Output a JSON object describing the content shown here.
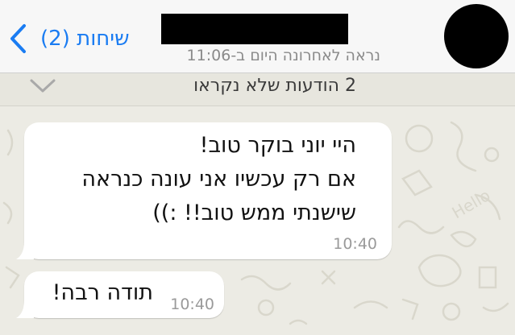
{
  "header": {
    "back_label": "שיחות (2)",
    "last_seen": "נראה לאחרונה היום ב-11:06"
  },
  "unread_banner": {
    "label": "2 הודעות שלא נקראו"
  },
  "messages": [
    {
      "lines": [
        "היי יוני בוקר טוב!",
        "אם רק עכשיו אני עונה כנראה",
        "שישנתי ממש טוב!! :))"
      ],
      "time": "10:40"
    },
    {
      "lines": [
        "תודה רבה!"
      ],
      "time": "10:40"
    }
  ],
  "colors": {
    "accent": "#1a7cf2",
    "navbar_bg": "#f7f7f7",
    "chat_bg": "#ecebe4",
    "bubble": "#ffffff"
  },
  "icons": {
    "back": "chevron-left-icon",
    "collapse": "chevron-down-icon"
  }
}
